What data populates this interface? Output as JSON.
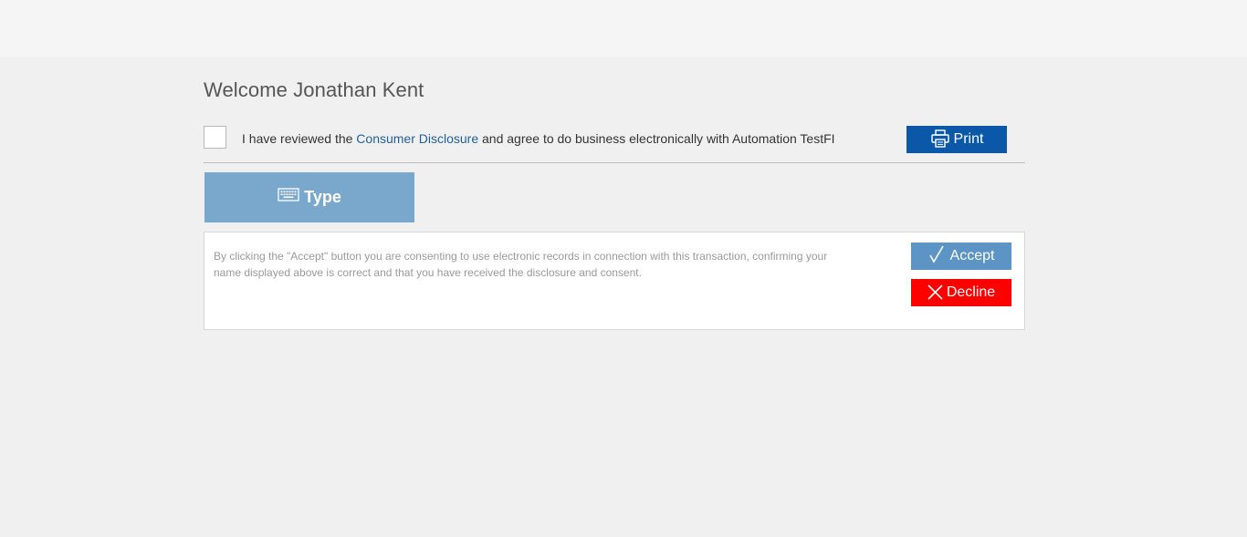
{
  "header": {
    "welcome": "Welcome Jonathan Kent"
  },
  "agreement": {
    "checked": false,
    "text_before": "I have reviewed the ",
    "link_text": "Consumer Disclosure",
    "text_after": " and agree to do business electronically with Automation TestFI"
  },
  "print_button": {
    "label": "Print",
    "icon": "printer-icon"
  },
  "signature_tabs": [
    {
      "label": "Type",
      "icon": "keyboard-icon",
      "active": true
    }
  ],
  "consent_panel": {
    "text": "By clicking the \"Accept\" button you are consenting to use electronic records in connection with this transaction, confirming your name displayed above is correct and that you have received the disclosure and consent.",
    "accept_label": "Accept",
    "accept_icon": "checkmark-icon",
    "decline_label": "Decline",
    "decline_icon": "close-icon"
  },
  "colors": {
    "page_background": "#f0f0f0",
    "print_button": "#0b58a8",
    "type_tab": "#7aa7cc",
    "accept_button": "#5b94c5",
    "decline_button": "#ff0000",
    "link": "#1f5f9e"
  }
}
